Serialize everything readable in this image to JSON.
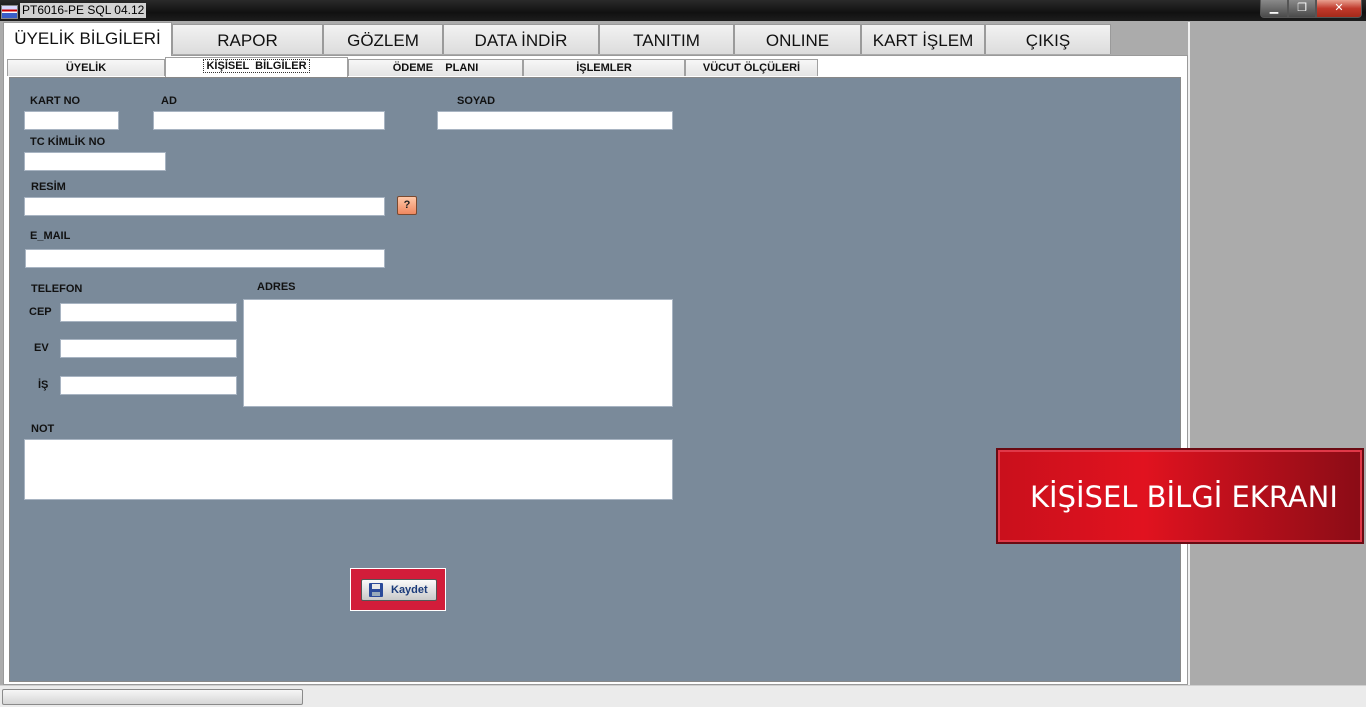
{
  "window": {
    "title": "PT6016-PE SQL 04.12",
    "minimize": "▁",
    "maximize": "❐",
    "close": "✕"
  },
  "main_tabs": [
    {
      "label": "ÜYELİK BİLGİLERİ"
    },
    {
      "label": "RAPOR"
    },
    {
      "label": "GÖZLEM"
    },
    {
      "label": "DATA İNDİR"
    },
    {
      "label": "TANITIM"
    },
    {
      "label": "ONLINE"
    },
    {
      "label": "KART İŞLEM"
    },
    {
      "label": "ÇIKIŞ"
    }
  ],
  "sub_tabs": [
    {
      "label": "ÜYELİK"
    },
    {
      "label": "KİŞİSEL  BİLGİLER"
    },
    {
      "label": "ÖDEME    PLANI"
    },
    {
      "label": "İŞLEMLER"
    },
    {
      "label": "VÜCUT ÖLÇÜLERİ"
    }
  ],
  "form": {
    "kart_no_label": "KART NO",
    "ad_label": "AD",
    "soyad_label": "SOYAD",
    "tc_label": "TC KİMLİK NO",
    "resim_label": "RESİM",
    "resim_help": "?",
    "email_label": "E_MAIL",
    "telefon_label": "TELEFON",
    "adres_label": "ADRES",
    "cep_label": "CEP",
    "ev_label": "EV",
    "is_label": "İŞ",
    "not_label": "NOT",
    "save_label": "Kaydet"
  },
  "banner": {
    "text": "KİŞİSEL BİLGİ EKRANI"
  }
}
